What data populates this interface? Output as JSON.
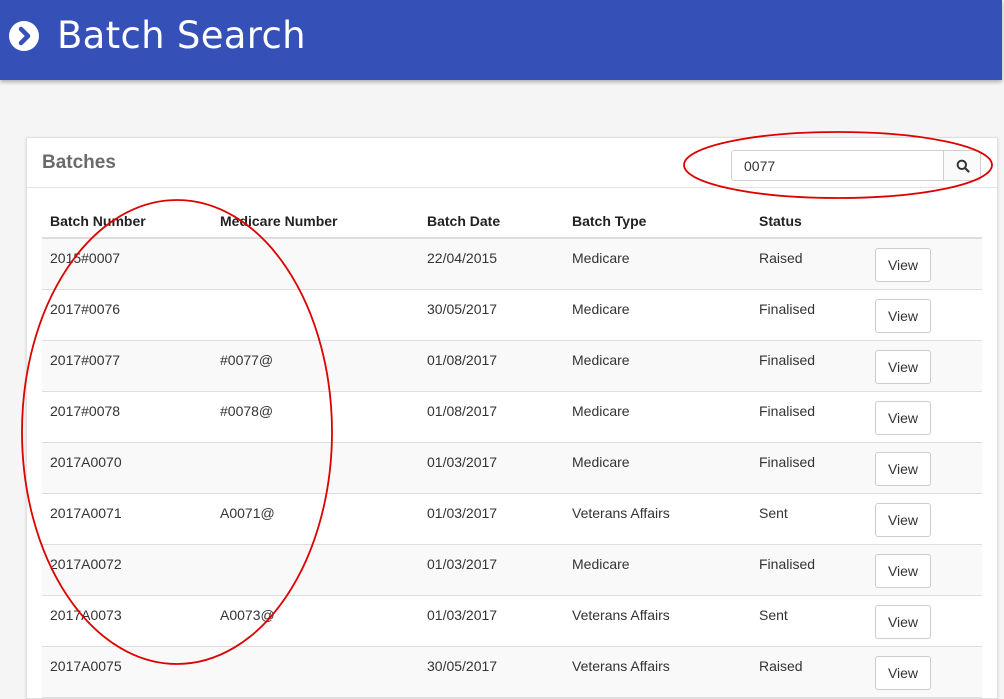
{
  "header": {
    "title": "Batch Search",
    "icon": "chevron-circle-right-icon",
    "background": "#3550b6"
  },
  "panel": {
    "title": "Batches",
    "search": {
      "value": "0077",
      "button_icon": "search-icon"
    }
  },
  "table": {
    "columns": [
      "Batch Number",
      "Medicare Number",
      "Batch Date",
      "Batch Type",
      "Status",
      ""
    ],
    "rows": [
      {
        "batch_number": "2015#0007",
        "medicare_number": "",
        "batch_date": "22/04/2015",
        "batch_type": "Medicare",
        "status": "Raised",
        "action": "View"
      },
      {
        "batch_number": "2017#0076",
        "medicare_number": "",
        "batch_date": "30/05/2017",
        "batch_type": "Medicare",
        "status": "Finalised",
        "action": "View"
      },
      {
        "batch_number": "2017#0077",
        "medicare_number": "#0077@",
        "batch_date": "01/08/2017",
        "batch_type": "Medicare",
        "status": "Finalised",
        "action": "View"
      },
      {
        "batch_number": "2017#0078",
        "medicare_number": "#0078@",
        "batch_date": "01/08/2017",
        "batch_type": "Medicare",
        "status": "Finalised",
        "action": "View"
      },
      {
        "batch_number": "2017A0070",
        "medicare_number": "",
        "batch_date": "01/03/2017",
        "batch_type": "Medicare",
        "status": "Finalised",
        "action": "View"
      },
      {
        "batch_number": "2017A0071",
        "medicare_number": "A0071@",
        "batch_date": "01/03/2017",
        "batch_type": "Veterans Affairs",
        "status": "Sent",
        "action": "View"
      },
      {
        "batch_number": "2017A0072",
        "medicare_number": "",
        "batch_date": "01/03/2017",
        "batch_type": "Medicare",
        "status": "Finalised",
        "action": "View"
      },
      {
        "batch_number": "2017A0073",
        "medicare_number": "A0073@",
        "batch_date": "01/03/2017",
        "batch_type": "Veterans Affairs",
        "status": "Sent",
        "action": "View"
      },
      {
        "batch_number": "2017A0075",
        "medicare_number": "",
        "batch_date": "30/05/2017",
        "batch_type": "Veterans Affairs",
        "status": "Raised",
        "action": "View"
      }
    ]
  },
  "annotations": {
    "color": "#dd0000"
  }
}
